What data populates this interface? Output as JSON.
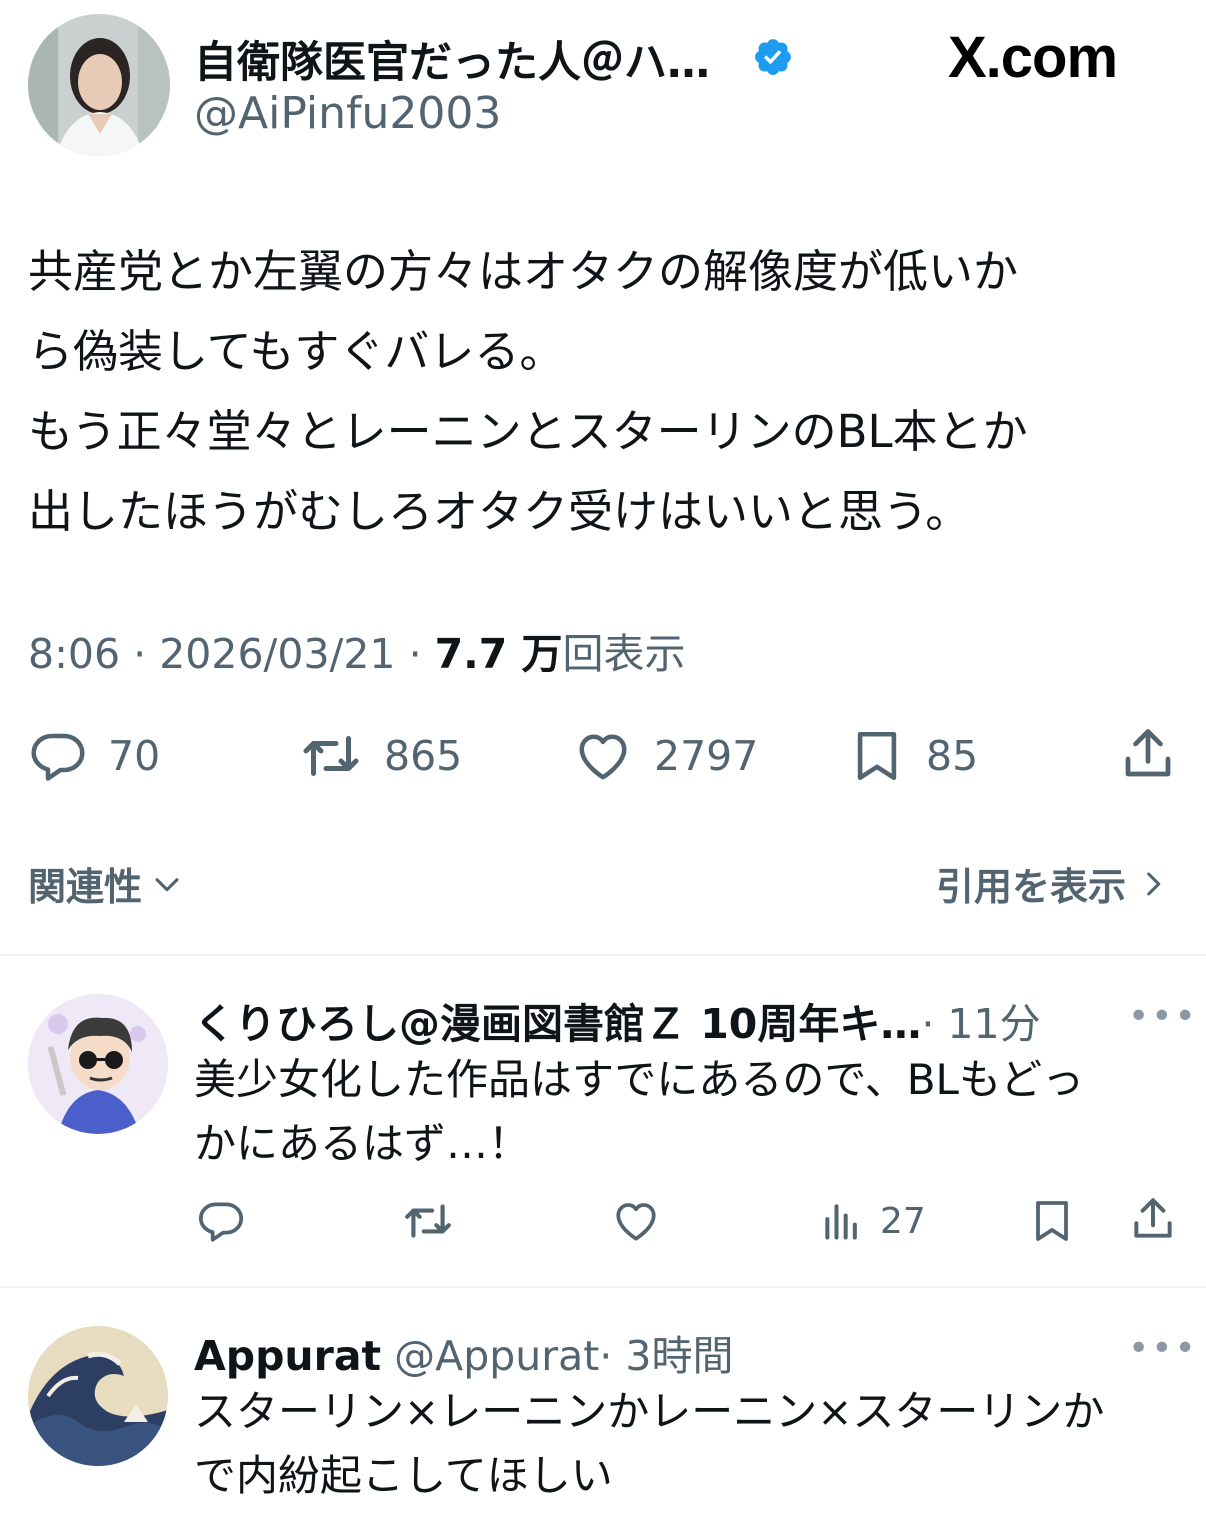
{
  "header": {
    "author_name": "自衛隊医官だった人＠ハ…",
    "author_handle": "@AiPinfu2003",
    "site_logo": "X.com",
    "verified_icon": "verified-badge-icon"
  },
  "tweet": {
    "text": "共産党とか左翼の方々はオタクの解像度が低いか\nら偽装してもすぐバレる。\nもう正々堂々とレーニンとスターリンのBL本とか\n出したほうがむしろオタク受けはいいと思う。",
    "time": "8:06",
    "date": "2026/03/21",
    "views": "7.7 万",
    "views_label": "回表示"
  },
  "actions": {
    "replies": "70",
    "retweets": "865",
    "likes": "2797",
    "bookmarks": "85"
  },
  "filters": {
    "relevance_label": "関連性",
    "quotes_label": "引用を表示"
  },
  "replies": [
    {
      "name": "くりひろし@漫画図書館Ｚ 10周年キ…",
      "meta": "· 11分",
      "text": "美少女化した作品はすでにあるので、BLもどっ\nかにあるはず…！",
      "views": "27"
    },
    {
      "name": "Appurat",
      "handle": "@Appurat",
      "meta": "· 3時間",
      "text": "スターリン×レーニンかレーニン×スターリンか\nで内紛起こしてほしい"
    }
  ],
  "colors": {
    "text_primary": "#0f1419",
    "text_secondary": "#536471",
    "verified_blue": "#1d9bf0",
    "divider": "#eff3f4"
  }
}
